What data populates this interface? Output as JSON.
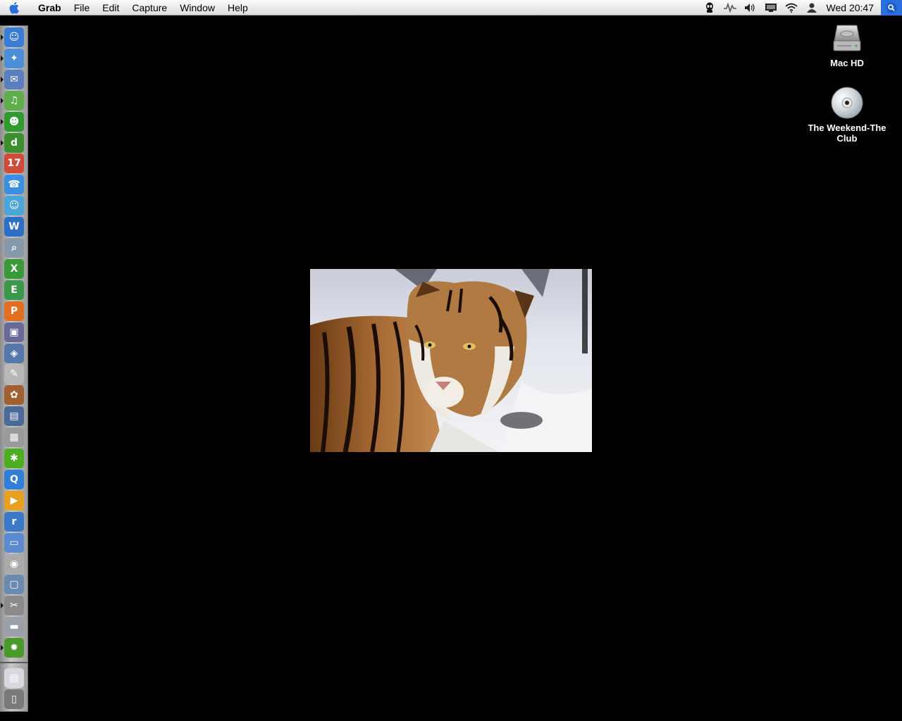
{
  "menubar": {
    "app_name": "Grab",
    "menus": [
      "File",
      "Edit",
      "Capture",
      "Window",
      "Help"
    ],
    "status_icons": [
      "bluetooth-like-alien-icon",
      "activity-monitor-icon",
      "volume-icon",
      "display-icon",
      "wifi-icon",
      "user-icon"
    ],
    "clock": "Wed 20:47"
  },
  "desktop": {
    "icons": [
      {
        "label": "Mac HD",
        "icon": "hard-drive-icon"
      },
      {
        "label": "The Weekend-The Club",
        "icon": "cd-icon"
      }
    ]
  },
  "dock": {
    "items": [
      {
        "name": "finder-icon",
        "glyph": "☺",
        "color": "#3a7bd5",
        "running": true
      },
      {
        "name": "safari-icon",
        "glyph": "✦",
        "color": "#4a8fd8",
        "running": true
      },
      {
        "name": "mail-icon",
        "glyph": "✉",
        "color": "#5a7fbf",
        "running": true
      },
      {
        "name": "itunes-icon",
        "glyph": "♫",
        "color": "#5fae4a",
        "running": true
      },
      {
        "name": "adium-icon",
        "glyph": "☻",
        "color": "#2f9b2f",
        "running": true
      },
      {
        "name": "dreamweaver-icon",
        "glyph": "d",
        "color": "#3d8f2d",
        "running": true
      },
      {
        "name": "ical-icon",
        "glyph": "17",
        "color": "#d04a3a",
        "running": false
      },
      {
        "name": "ichat-icon",
        "glyph": "☎",
        "color": "#3b8ee0",
        "running": false
      },
      {
        "name": "messenger-icon",
        "glyph": "☺",
        "color": "#4aa6d8",
        "running": false
      },
      {
        "name": "word-icon",
        "glyph": "W",
        "color": "#2b6fc7",
        "running": false
      },
      {
        "name": "preview-icon",
        "glyph": "⌕",
        "color": "#8899aa",
        "running": false
      },
      {
        "name": "excel-icon",
        "glyph": "X",
        "color": "#3a9a3a",
        "running": false
      },
      {
        "name": "entourage-icon",
        "glyph": "E",
        "color": "#3a9a4a",
        "running": false
      },
      {
        "name": "powerpoint-icon",
        "glyph": "P",
        "color": "#e07020",
        "running": false
      },
      {
        "name": "iphoto-icon",
        "glyph": "▣",
        "color": "#6a6a9a",
        "running": false
      },
      {
        "name": "photo-app-icon",
        "glyph": "◈",
        "color": "#5577aa",
        "running": false
      },
      {
        "name": "textedit-icon",
        "glyph": "✎",
        "color": "#b8b8b8",
        "running": false
      },
      {
        "name": "game-icon",
        "glyph": "✿",
        "color": "#a06030",
        "running": false
      },
      {
        "name": "system-app-icon",
        "glyph": "▤",
        "color": "#4a6a9a",
        "running": false
      },
      {
        "name": "calculator-icon",
        "glyph": "▦",
        "color": "#9a9a9a",
        "running": false
      },
      {
        "name": "limewire-icon",
        "glyph": "✱",
        "color": "#4caf20",
        "running": false
      },
      {
        "name": "quicktime-icon",
        "glyph": "Q",
        "color": "#2f7fd8",
        "running": false
      },
      {
        "name": "media-player-icon",
        "glyph": "▶",
        "color": "#e8a020",
        "running": false
      },
      {
        "name": "realplayer-icon",
        "glyph": "r",
        "color": "#3a7ac8",
        "running": false
      },
      {
        "name": "remote-desktop-icon",
        "glyph": "▭",
        "color": "#5a8ad0",
        "running": false
      },
      {
        "name": "disk-utility-icon",
        "glyph": "◉",
        "color": "#aaaaaa",
        "running": false
      },
      {
        "name": "monitor-icon",
        "glyph": "▢",
        "color": "#6a8ab0",
        "running": false
      },
      {
        "name": "grab-icon",
        "glyph": "✂",
        "color": "#8a8a8a",
        "running": true
      },
      {
        "name": "printer-icon",
        "glyph": "▬",
        "color": "#9aa0aa",
        "running": false
      },
      {
        "name": "system-prefs-icon",
        "glyph": "✹",
        "color": "#4a9a2a",
        "running": true
      },
      {
        "name": "document-icon",
        "glyph": "▤",
        "color": "#d8d8e0",
        "running": false
      },
      {
        "name": "trash-icon",
        "glyph": "▯",
        "color": "#7a7a7a",
        "running": false
      }
    ]
  },
  "wallpaper": {
    "subject": "tiger-photo"
  }
}
